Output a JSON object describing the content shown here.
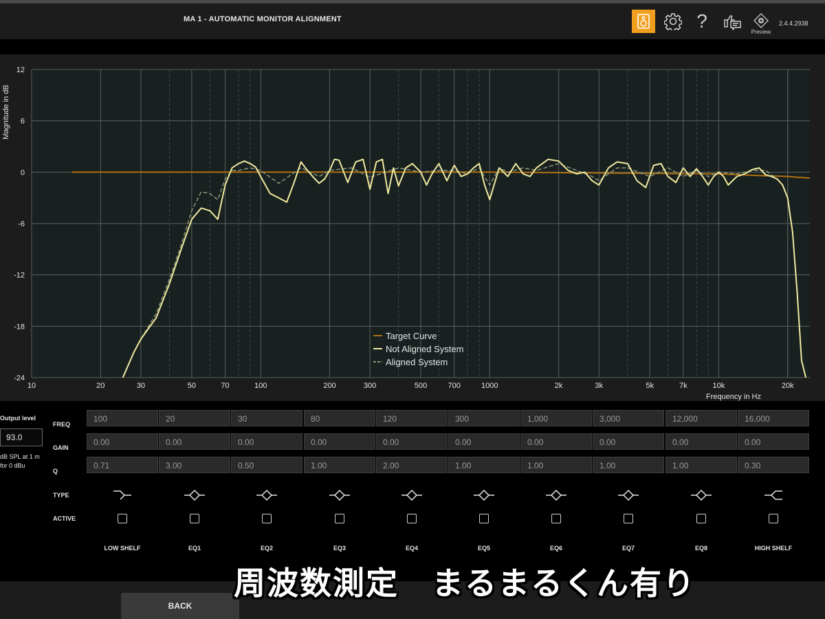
{
  "header": {
    "title": "MA 1 - AUTOMATIC MONITOR ALIGNMENT",
    "preview_label": "Preview",
    "version": "2.4.4.2938",
    "help_glyph": "?",
    "icons": [
      "speaker-icon",
      "gear-icon",
      "help-icon",
      "feedback-icon",
      "preview-icon"
    ],
    "accent_color": "#f0a01e"
  },
  "chart_data": {
    "type": "line",
    "title": "",
    "ylabel": "Magnitude in dB",
    "xlabel": "Frequency in Hz",
    "x_scale": "log",
    "xlim": [
      10,
      25000
    ],
    "ylim": [
      -24,
      12
    ],
    "grid": true,
    "y_ticks": [
      "12",
      "6",
      "0",
      "-6",
      "-12",
      "-18",
      "-24"
    ],
    "x_ticks": [
      "10",
      "20",
      "30",
      "50",
      "70",
      "100",
      "200",
      "300",
      "500",
      "700",
      "1000",
      "2k",
      "3k",
      "5k",
      "7k",
      "10k",
      "20k"
    ],
    "legend_position": "center-bottom",
    "series": [
      {
        "name": "Target Curve",
        "color": "#b07010",
        "style": "solid",
        "x": [
          15,
          100,
          1000,
          10000,
          15000,
          20000,
          25000
        ],
        "y": [
          0,
          0,
          0,
          -0.2,
          -0.4,
          -0.5,
          -0.7
        ]
      },
      {
        "name": "Not Aligned System",
        "color": "#f0eaa0",
        "style": "solid",
        "x": [
          25,
          28,
          30,
          35,
          40,
          45,
          50,
          55,
          60,
          65,
          70,
          75,
          80,
          85,
          90,
          95,
          100,
          110,
          120,
          130,
          140,
          150,
          160,
          170,
          180,
          190,
          200,
          210,
          220,
          240,
          260,
          280,
          300,
          320,
          340,
          360,
          380,
          400,
          430,
          460,
          500,
          530,
          560,
          600,
          650,
          700,
          750,
          800,
          850,
          900,
          950,
          1000,
          1100,
          1200,
          1300,
          1400,
          1500,
          1600,
          1800,
          2000,
          2200,
          2400,
          2600,
          2800,
          3000,
          3300,
          3600,
          4000,
          4400,
          4800,
          5200,
          5600,
          6000,
          6500,
          7000,
          7500,
          8000,
          8500,
          9000,
          9500,
          10000,
          10500,
          11000,
          12000,
          13000,
          14000,
          15000,
          16000,
          17000,
          18000,
          19000,
          20000,
          21000,
          22000,
          23000,
          24000
        ],
        "y": [
          -24,
          -21,
          -19.5,
          -17,
          -13,
          -9,
          -5.5,
          -4.2,
          -4.5,
          -5.5,
          -1.5,
          0.5,
          1,
          1.3,
          1,
          0.6,
          -0.5,
          -2.5,
          -3,
          -3.5,
          -1.2,
          1.2,
          0.2,
          -0.6,
          -1.3,
          -0.8,
          0.2,
          1.5,
          1.4,
          -1.2,
          1.2,
          1.5,
          -2,
          1.2,
          1.5,
          -2.5,
          0.5,
          -1.6,
          0.5,
          1,
          0,
          -1.5,
          -0.2,
          1,
          -1,
          0.8,
          -0.5,
          -0.2,
          0.5,
          1,
          -1.5,
          -3.2,
          0.5,
          -0.5,
          1,
          -0.2,
          -0.5,
          0.5,
          1.5,
          1.3,
          0.2,
          -0.2,
          0,
          -1,
          -1.5,
          0.5,
          1.2,
          1,
          -1,
          -1.8,
          0.8,
          1,
          -0.5,
          -1.2,
          0.5,
          -0.5,
          0.4,
          -0.5,
          -1.5,
          -0.5,
          0,
          -0.5,
          -1.5,
          -0.5,
          -0.2,
          0.3,
          0.5,
          -0.3,
          -0.5,
          -0.8,
          -1.5,
          -3,
          -7,
          -14,
          -22,
          -24
        ]
      },
      {
        "name": "Aligned System",
        "color": "#8a9a78",
        "style": "dashed",
        "x": [
          25,
          28,
          30,
          35,
          40,
          45,
          50,
          55,
          60,
          65,
          70,
          75,
          80,
          90,
          100,
          120,
          150,
          180,
          200,
          250,
          300,
          400,
          500,
          600,
          700,
          800,
          900,
          1000,
          1100,
          1200,
          1400,
          1600,
          2000,
          2400,
          2800,
          3000,
          3600,
          4000,
          5000,
          6000,
          7000,
          8000,
          9000,
          10000,
          12000,
          14000,
          16000,
          18000,
          19000,
          20000,
          21000,
          22000,
          23000,
          24000
        ],
        "y": [
          -24,
          -21,
          -19.5,
          -16.5,
          -12.5,
          -8.5,
          -4.5,
          -2.3,
          -2.5,
          -3.2,
          -0.8,
          0.2,
          0.2,
          0.5,
          0.2,
          -1.3,
          0.5,
          -0.5,
          0.2,
          0.5,
          -0.6,
          0.5,
          0,
          0.2,
          0.2,
          -0.2,
          0.5,
          -1.5,
          0.5,
          0,
          0.5,
          0.2,
          1,
          0.2,
          -0.5,
          -1,
          0.5,
          0.5,
          -0.5,
          0.5,
          -0.5,
          0.2,
          -0.5,
          0,
          -0.2,
          0.2,
          0.2,
          -0.8,
          -1.5,
          -3,
          -7,
          -14,
          -22,
          -24
        ]
      }
    ]
  },
  "eq": {
    "output_level_label": "Output level",
    "output_level_value": "93.0",
    "output_unit_text": "dB SPL at 1 m for 0 dBu",
    "row_labels": {
      "freq": "FREQ",
      "gain": "GAIN",
      "q": "Q",
      "type": "TYPE",
      "active": "ACTIVE"
    },
    "bands": [
      {
        "name": "LOW SHELF",
        "freq": "100",
        "gain": "0.00",
        "q": "0.71",
        "type": "low-shelf-icon",
        "active": false
      },
      {
        "name": "EQ1",
        "freq": "20",
        "gain": "0.00",
        "q": "3.00",
        "type": "peak-eq-icon",
        "active": false
      },
      {
        "name": "EQ2",
        "freq": "30",
        "gain": "0.00",
        "q": "0.50",
        "type": "peak-eq-icon",
        "active": false
      },
      {
        "name": "EQ3",
        "freq": "80",
        "gain": "0.00",
        "q": "1.00",
        "type": "peak-eq-icon",
        "active": false
      },
      {
        "name": "EQ4",
        "freq": "120",
        "gain": "0.00",
        "q": "2.00",
        "type": "peak-eq-icon",
        "active": false
      },
      {
        "name": "EQ5",
        "freq": "300",
        "gain": "0.00",
        "q": "1.00",
        "type": "peak-eq-icon",
        "active": false
      },
      {
        "name": "EQ6",
        "freq": "1,000",
        "gain": "0.00",
        "q": "1.00",
        "type": "peak-eq-icon",
        "active": false
      },
      {
        "name": "EQ7",
        "freq": "3,000",
        "gain": "0.00",
        "q": "1.00",
        "type": "peak-eq-icon",
        "active": false
      },
      {
        "name": "EQ8",
        "freq": "12,000",
        "gain": "0.00",
        "q": "1.00",
        "type": "peak-eq-icon",
        "active": false
      },
      {
        "name": "HIGH SHELF",
        "freq": "16,000",
        "gain": "0.00",
        "q": "0.30",
        "type": "high-shelf-icon",
        "active": false
      }
    ]
  },
  "footer": {
    "back_label": "BACK",
    "caption": "周波数測定　まるまるくん有り"
  }
}
